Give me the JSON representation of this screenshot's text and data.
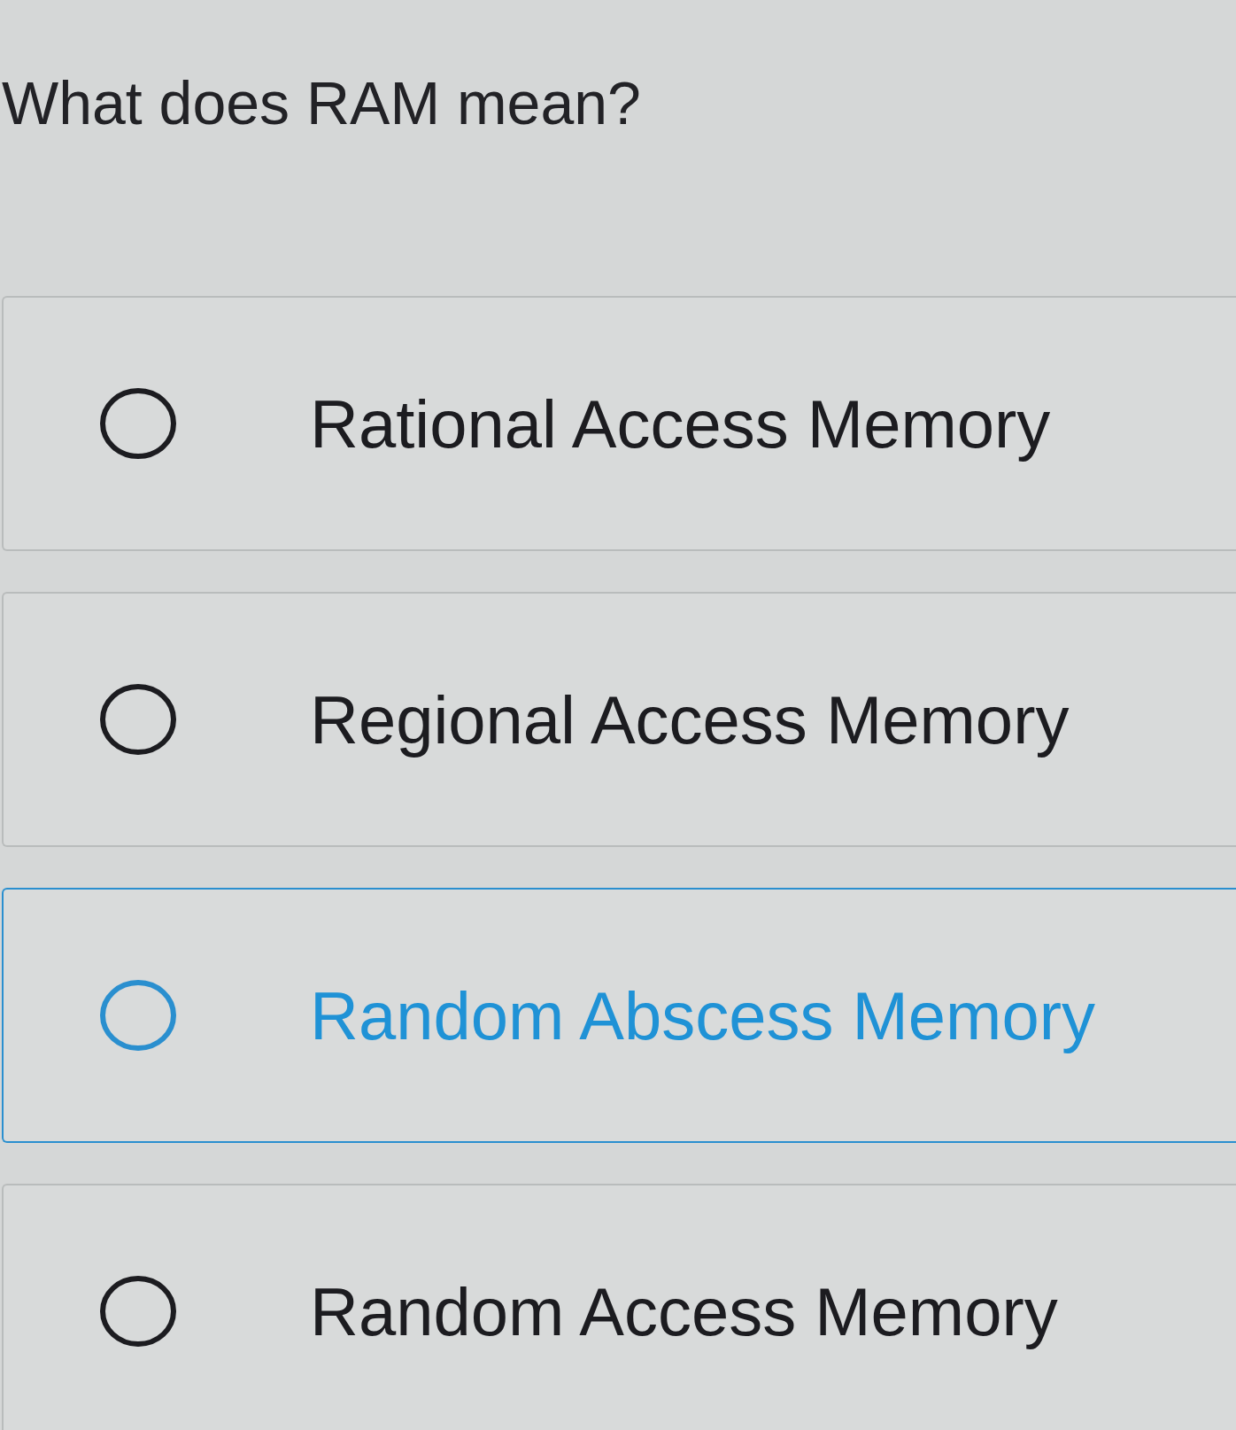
{
  "question": {
    "text": "What does RAM mean?"
  },
  "options": [
    {
      "label": "Rational Access Memory",
      "checked": false,
      "hovered": false
    },
    {
      "label": "Regional Access Memory",
      "checked": false,
      "hovered": false
    },
    {
      "label": "Random Abscess Memory",
      "checked": false,
      "hovered": true
    },
    {
      "label": "Random Access Memory",
      "checked": false,
      "hovered": false
    }
  ]
}
